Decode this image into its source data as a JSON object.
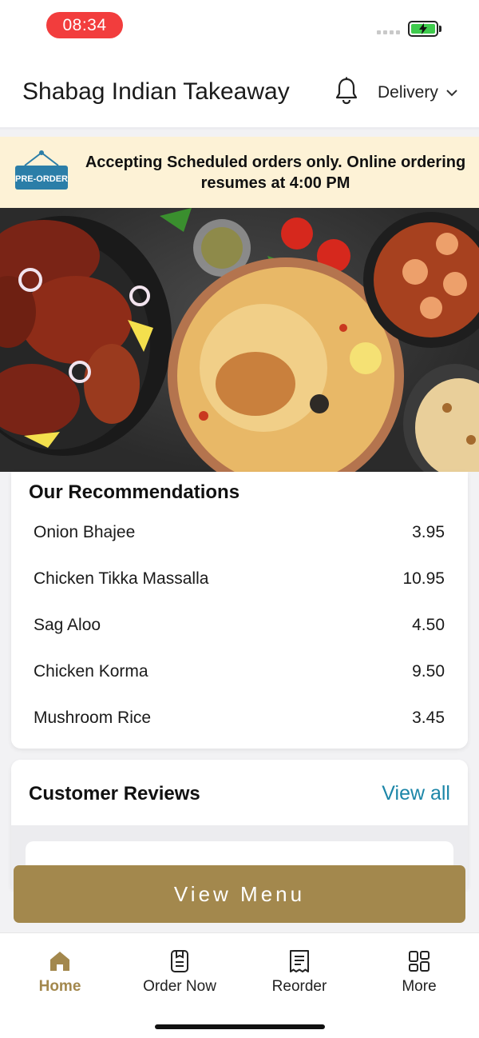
{
  "status": {
    "time": "08:34",
    "battery_color": "#3fcb4d"
  },
  "header": {
    "title": "Shabag Indian Takeaway",
    "mode": "Delivery",
    "icons": [
      "bell-icon",
      "chevron-down-icon"
    ]
  },
  "banner": {
    "badge": "PRE-ORDER",
    "text": "Accepting Scheduled orders only. Online ordering resumes at 4:00 PM"
  },
  "recommendations": {
    "title": "Our Recommendations",
    "items": [
      {
        "name": "Onion Bhajee",
        "price": "3.95"
      },
      {
        "name": "Chicken Tikka Massalla",
        "price": "10.95"
      },
      {
        "name": "Sag Aloo",
        "price": "4.50"
      },
      {
        "name": "Chicken Korma",
        "price": "9.50"
      },
      {
        "name": "Mushroom Rice",
        "price": "3.45"
      }
    ]
  },
  "reviews": {
    "title": "Customer Reviews",
    "view_all": "View all"
  },
  "cta": {
    "label": "View Menu",
    "color": "#a3884d"
  },
  "tabs": [
    {
      "label": "Home",
      "icon": "home-icon",
      "active": true
    },
    {
      "label": "Order Now",
      "icon": "order-icon",
      "active": false
    },
    {
      "label": "Reorder",
      "icon": "receipt-icon",
      "active": false
    },
    {
      "label": "More",
      "icon": "grid-icon",
      "active": false
    }
  ],
  "colors": {
    "accent": "#a3884d",
    "link": "#1c86a8",
    "banner_bg": "#fdf2d6",
    "time_pill": "#f23d3d"
  }
}
